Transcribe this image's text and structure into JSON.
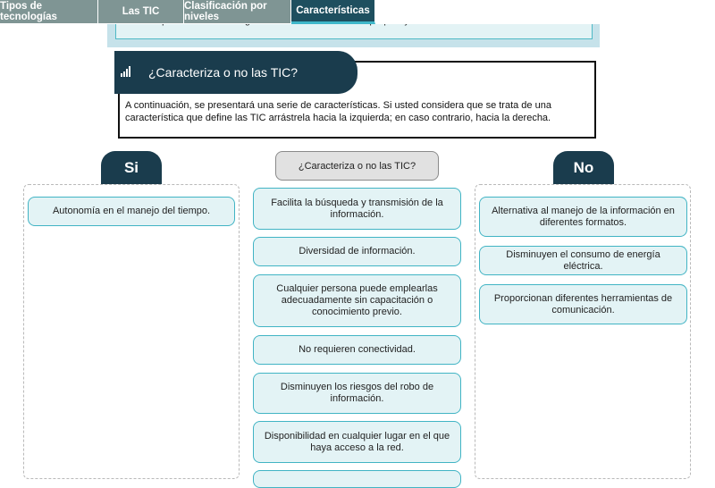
{
  "tabs": [
    {
      "label": "Tipos de tecnologías",
      "active": false
    },
    {
      "label": "Las TIC",
      "active": false
    },
    {
      "label": "Clasificación por niveles",
      "active": false
    },
    {
      "label": "Características",
      "active": true
    }
  ],
  "intro": {
    "text": "Identifique cuáles de las siguientes características son propias y definen las TIC:"
  },
  "question": {
    "title": "¿Caracteriza o no las TIC?",
    "description": "A continuación, se presentará una serie de características. Si usted considera que se trata de una característica que define las TIC arrástrela hacia la izquierda; en caso contrario, hacia la derecha."
  },
  "columns": {
    "si": {
      "label": "Si"
    },
    "center": {
      "label": "¿Caracteriza o no las TIC?"
    },
    "no": {
      "label": "No"
    }
  },
  "cards": {
    "si": [
      "Autonomía en el manejo del tiempo."
    ],
    "center": [
      "Facilita la búsqueda y transmisión de la información.",
      "Diversidad de información.",
      "Cualquier persona puede emplearlas adecuadamente sin capacitación o conocimiento previo.",
      "No requieren conectividad.",
      "Disminuyen los riesgos del robo de información.",
      "Disponibilidad en cualquier lugar en el que haya acceso a la red."
    ],
    "no": [
      "Alternativa al manejo de la información en diferentes formatos.",
      "Disminuyen el consumo de energía eléctrica.",
      "Proporcionan diferentes herramientas de comunicación."
    ]
  },
  "colors": {
    "header_dark": "#1a3c4d",
    "tab_inactive": "#7f9594",
    "accent": "#41b4c4",
    "card_bg": "#e3f3f5"
  },
  "icons": {
    "header_icon": "bar-chart-icon"
  }
}
